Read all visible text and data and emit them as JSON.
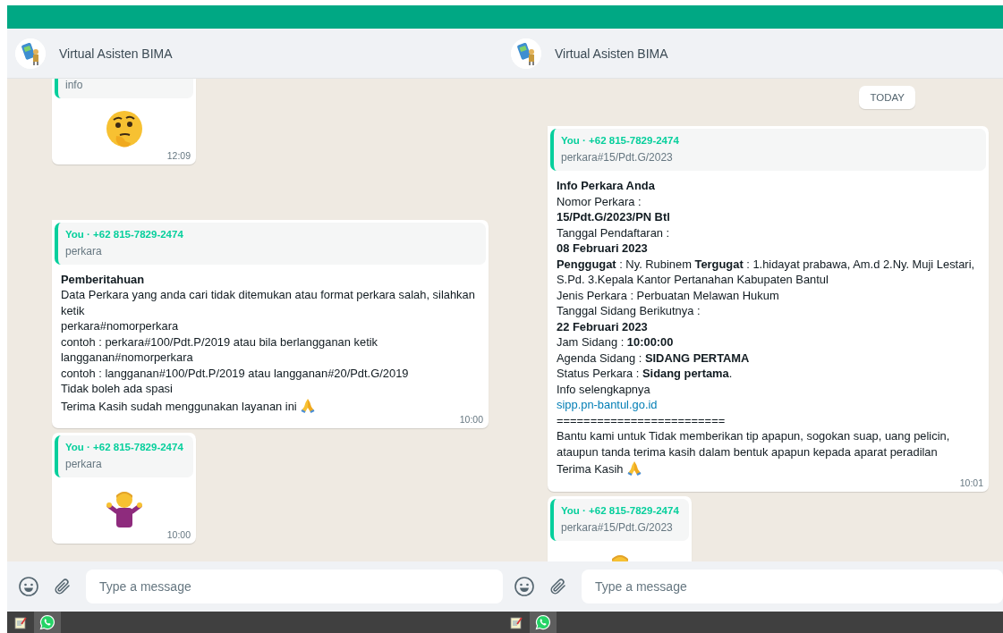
{
  "panes": [
    {
      "contact": {
        "name": "Virtual Asisten BIMA"
      },
      "chat": [
        {
          "kind": "thinking",
          "tail": false,
          "clipped_top": true,
          "quote": {
            "text": "info"
          },
          "time": "12:09"
        },
        {
          "kind": "text",
          "tail": true,
          "clipped_top": false,
          "quote": {
            "author": "You · +62 815-7829-2474",
            "text": "perkara"
          },
          "lines": [
            {
              "kind": "bold",
              "text": "Pemberitahuan"
            },
            {
              "kind": "plain",
              "text": "Data Perkara yang anda cari tidak ditemukan atau format perkara salah, silahkan ketik"
            },
            {
              "kind": "plain",
              "text": "perkara#nomorperkara"
            },
            {
              "kind": "plain",
              "text": "contoh : perkara#100/Pdt.P/2019 atau bila berlangganan ketik langganan#nomorperkara"
            },
            {
              "kind": "plain",
              "text": "contoh : langganan#100/Pdt.P/2019 atau langganan#20/Pdt.G/2019"
            },
            {
              "kind": "plain",
              "text": "Tidak boleh ada spasi"
            },
            {
              "kind": "pray",
              "text": "Terima Kasih sudah menggunakan layanan ini"
            }
          ],
          "time": "10:00"
        },
        {
          "kind": "shrug",
          "tail": false,
          "clipped_top": false,
          "quote": {
            "author": "You · +62 815-7829-2474",
            "text": "perkara"
          },
          "time": "10:00"
        }
      ],
      "composer": {
        "placeholder": "Type a message"
      },
      "taskbar": [
        {
          "kind": "notepad",
          "selected": false
        },
        {
          "kind": "chat",
          "selected": true
        }
      ]
    },
    {
      "contact": {
        "name": "Virtual Asisten BIMA"
      },
      "chat": [
        {
          "kind": "date",
          "text": "TODAY"
        },
        {
          "kind": "text",
          "tail": true,
          "clipped_top": false,
          "quote": {
            "author": "You · +62 815-7829-2474",
            "text": "perkara#15/Pdt.G/2023"
          },
          "lines": [
            {
              "kind": "bold",
              "text": "Info Perkara Anda"
            },
            {
              "kind": "plain",
              "text": "Nomor Perkara :"
            },
            {
              "kind": "bold",
              "text": "15/Pdt.G/2023/PN Btl"
            },
            {
              "kind": "plain",
              "text": "Tanggal Pendaftaran :"
            },
            {
              "kind": "bold",
              "text": "08 Februari 2023"
            },
            {
              "kind": "plain",
              "text": "**Penggugat** : Ny. Rubinem **Tergugat** : 1.hidayat prabawa, Am.d 2.Ny. Muji Lestari, S.Pd. 3.Kepala Kantor Pertanahan Kabupaten Bantul"
            },
            {
              "kind": "plain",
              "text": "Jenis Perkara : Perbuatan Melawan Hukum"
            },
            {
              "kind": "plain",
              "text": "Tanggal Sidang Berikutnya :"
            },
            {
              "kind": "bold",
              "text": "22 Februari 2023"
            },
            {
              "kind": "plain",
              "text": "Jam Sidang : **10:00:00**"
            },
            {
              "kind": "plain",
              "text": "Agenda Sidang : **SIDANG PERTAMA**"
            },
            {
              "kind": "plain",
              "text": "Status Perkara : **Sidang pertama**."
            },
            {
              "kind": "plain",
              "text": "Info selengkapnya"
            },
            {
              "kind": "link",
              "text": "sipp.pn-bantul.go.id"
            },
            {
              "kind": "plain",
              "text": "========================="
            },
            {
              "kind": "plain",
              "text": "Bantu kami untuk Tidak memberikan tip apapun, sogokan suap, uang pelicin, ataupun tanda terima kasih dalam bentuk apapun kepada aparat peradilan"
            },
            {
              "kind": "pray",
              "text": "Terima Kasih"
            }
          ],
          "time": "10:01"
        },
        {
          "kind": "shrug",
          "tail": false,
          "clipped_top": false,
          "quote": {
            "author": "You · +62 815-7829-2474",
            "text": "perkara#15/Pdt.G/2023"
          }
        }
      ],
      "composer": {
        "placeholder": "Type a message"
      },
      "taskbar": [
        {
          "kind": "notepad",
          "selected": false
        },
        {
          "kind": "chat",
          "selected": true
        }
      ]
    }
  ]
}
